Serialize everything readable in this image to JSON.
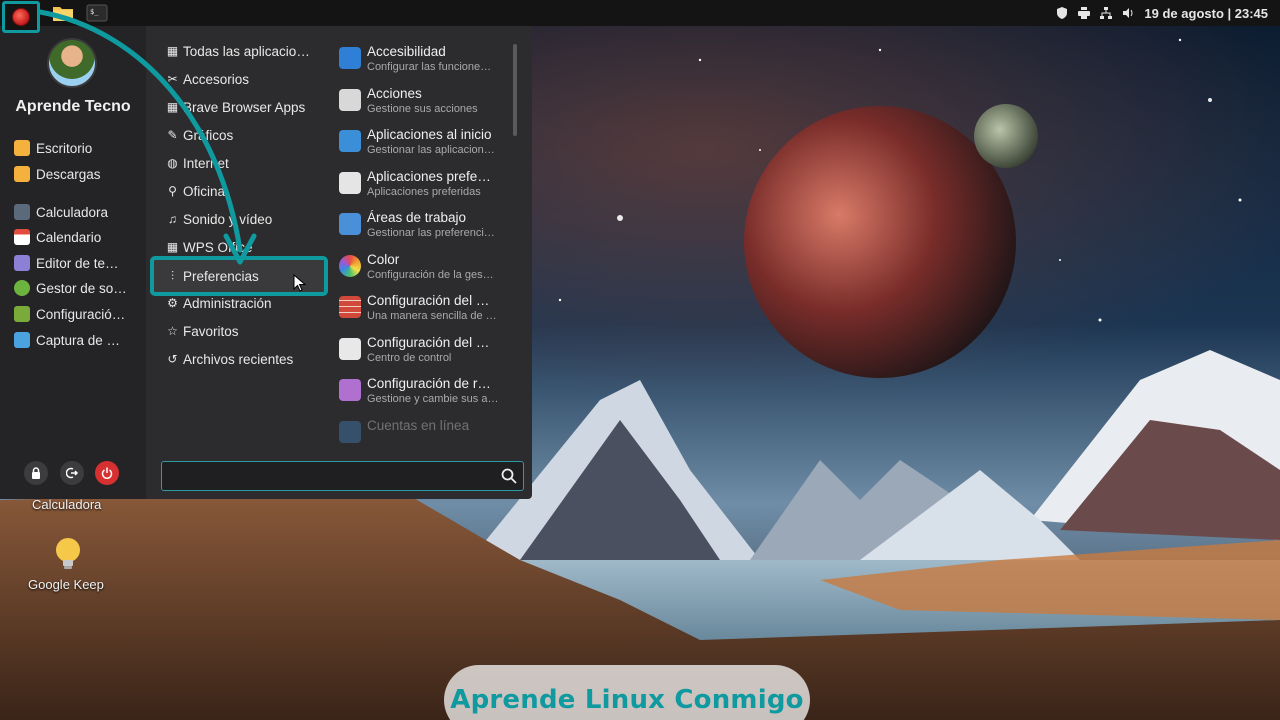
{
  "panel": {
    "clock": "19 de agosto | 23:45",
    "launcher_icon": "app-menu-bird-icon",
    "apps": [
      "folder-icon",
      "terminal-icon"
    ],
    "tray_icons": [
      "shield-icon",
      "printer-icon",
      "network-icon",
      "volume-icon"
    ]
  },
  "menu": {
    "user_name": "Aprende Tecno",
    "sidebar": [
      {
        "label": "Escritorio",
        "icon": "folder-icon",
        "color": "#f5b13d"
      },
      {
        "label": "Descargas",
        "icon": "downloads-folder-icon",
        "color": "#f5b13d"
      },
      {
        "label": "Calculadora",
        "icon": "calculator-icon",
        "color": "#5a6a7a"
      },
      {
        "label": "Calendario",
        "icon": "calendar-icon",
        "color": "#e24b3f"
      },
      {
        "label": "Editor de te…",
        "icon": "text-editor-icon",
        "color": "#8c7fd6"
      },
      {
        "label": "Gestor de so…",
        "icon": "software-manager-icon",
        "color": "#6cb33f"
      },
      {
        "label": "Configuració…",
        "icon": "settings-icon",
        "color": "#7aaa3a"
      },
      {
        "label": "Captura de …",
        "icon": "screenshot-icon",
        "color": "#4aa3df"
      }
    ],
    "categories": [
      {
        "label": "Todas las aplicacio…",
        "icon": "grid-icon"
      },
      {
        "label": "Accesorios",
        "icon": "scissors-icon"
      },
      {
        "label": "Brave Browser Apps",
        "icon": "grid-icon"
      },
      {
        "label": "Gráficos",
        "icon": "graphics-icon"
      },
      {
        "label": "Internet",
        "icon": "globe-icon"
      },
      {
        "label": "Oficina",
        "icon": "paperclip-icon"
      },
      {
        "label": "Sonido y vídeo",
        "icon": "music-icon"
      },
      {
        "label": "WPS Office",
        "icon": "grid-icon"
      },
      {
        "label": "Preferencias",
        "icon": "sliders-icon"
      },
      {
        "label": "Administración",
        "icon": "gear-icon"
      },
      {
        "label": "Favoritos",
        "icon": "star-icon"
      },
      {
        "label": "Archivos recientes",
        "icon": "history-icon"
      }
    ],
    "apps": [
      {
        "name": "Accesibilidad",
        "desc": "Configurar las funcione…",
        "icon": "accessibility-icon",
        "color": "#2f7fd6"
      },
      {
        "name": "Acciones",
        "desc": "Gestione sus acciones",
        "icon": "actions-list-icon",
        "color": "#d8d8d8"
      },
      {
        "name": "Aplicaciones al inicio",
        "desc": "Gestionar las aplicacion…",
        "icon": "startup-apps-icon",
        "color": "#3b8fd9"
      },
      {
        "name": "Aplicaciones prefe…",
        "desc": "Aplicaciones preferidas",
        "icon": "preferred-apps-icon",
        "color": "#e5e5e5"
      },
      {
        "name": "Áreas de trabajo",
        "desc": "Gestionar las preferenci…",
        "icon": "workspaces-icon",
        "color": "#4a90d9"
      },
      {
        "name": "Color",
        "desc": "Configuración de la ges…",
        "icon": "color-icon",
        "color": "#f0a030"
      },
      {
        "name": "Configuración del …",
        "desc": "Una manera sencilla de …",
        "icon": "firewall-icon",
        "color": "#d0493a"
      },
      {
        "name": "Configuración del …",
        "desc": "Centro de control",
        "icon": "control-center-icon",
        "color": "#e8e8e8"
      },
      {
        "name": "Configuración de r…",
        "desc": "Gestione y cambie sus a…",
        "icon": "network-settings-icon",
        "color": "#b070d0"
      },
      {
        "name": "Cuentas en línea",
        "desc": "",
        "icon": "online-accounts-icon",
        "color": "#4a90d9"
      }
    ],
    "search": {
      "value": "",
      "placeholder": ""
    }
  },
  "desktop": {
    "icons": [
      {
        "label": "Calculadora"
      },
      {
        "label": "Google Keep",
        "icon": "google-keep-icon"
      }
    ]
  },
  "watermark": "Aprende Linux Conmigo",
  "accent": "#0f9aa0"
}
